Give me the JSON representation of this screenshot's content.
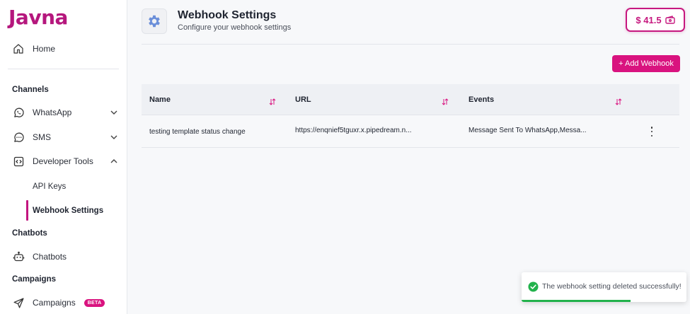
{
  "brand": {
    "logo": "Javna",
    "accent": "#c6187f"
  },
  "sidebar": {
    "home": "Home",
    "channels_heading": "Channels",
    "whatsapp": "WhatsApp",
    "sms": "SMS",
    "developer_tools": "Developer Tools",
    "api_keys": "API Keys",
    "webhook_settings": "Webhook Settings",
    "chatbots_heading": "Chatbots",
    "chatbots": "Chatbots",
    "campaigns_heading": "Campaigns",
    "campaigns": "Campaigns",
    "beta_badge": "BETA"
  },
  "header": {
    "title": "Webhook Settings",
    "subtitle": "Configure your webhook settings",
    "balance": "$ 41.5",
    "add_button": "+ Add Webhook"
  },
  "table": {
    "columns": [
      "Name",
      "URL",
      "Events"
    ],
    "rows": [
      {
        "name": "testing template status change",
        "url": "https://enqnief5tguxr.x.pipedream.n...",
        "events": "Message Sent To WhatsApp,Messa..."
      }
    ]
  },
  "toast": {
    "message": "The webhook setting deleted successfully!",
    "progress_percent": 66,
    "color": "#22b24c"
  }
}
